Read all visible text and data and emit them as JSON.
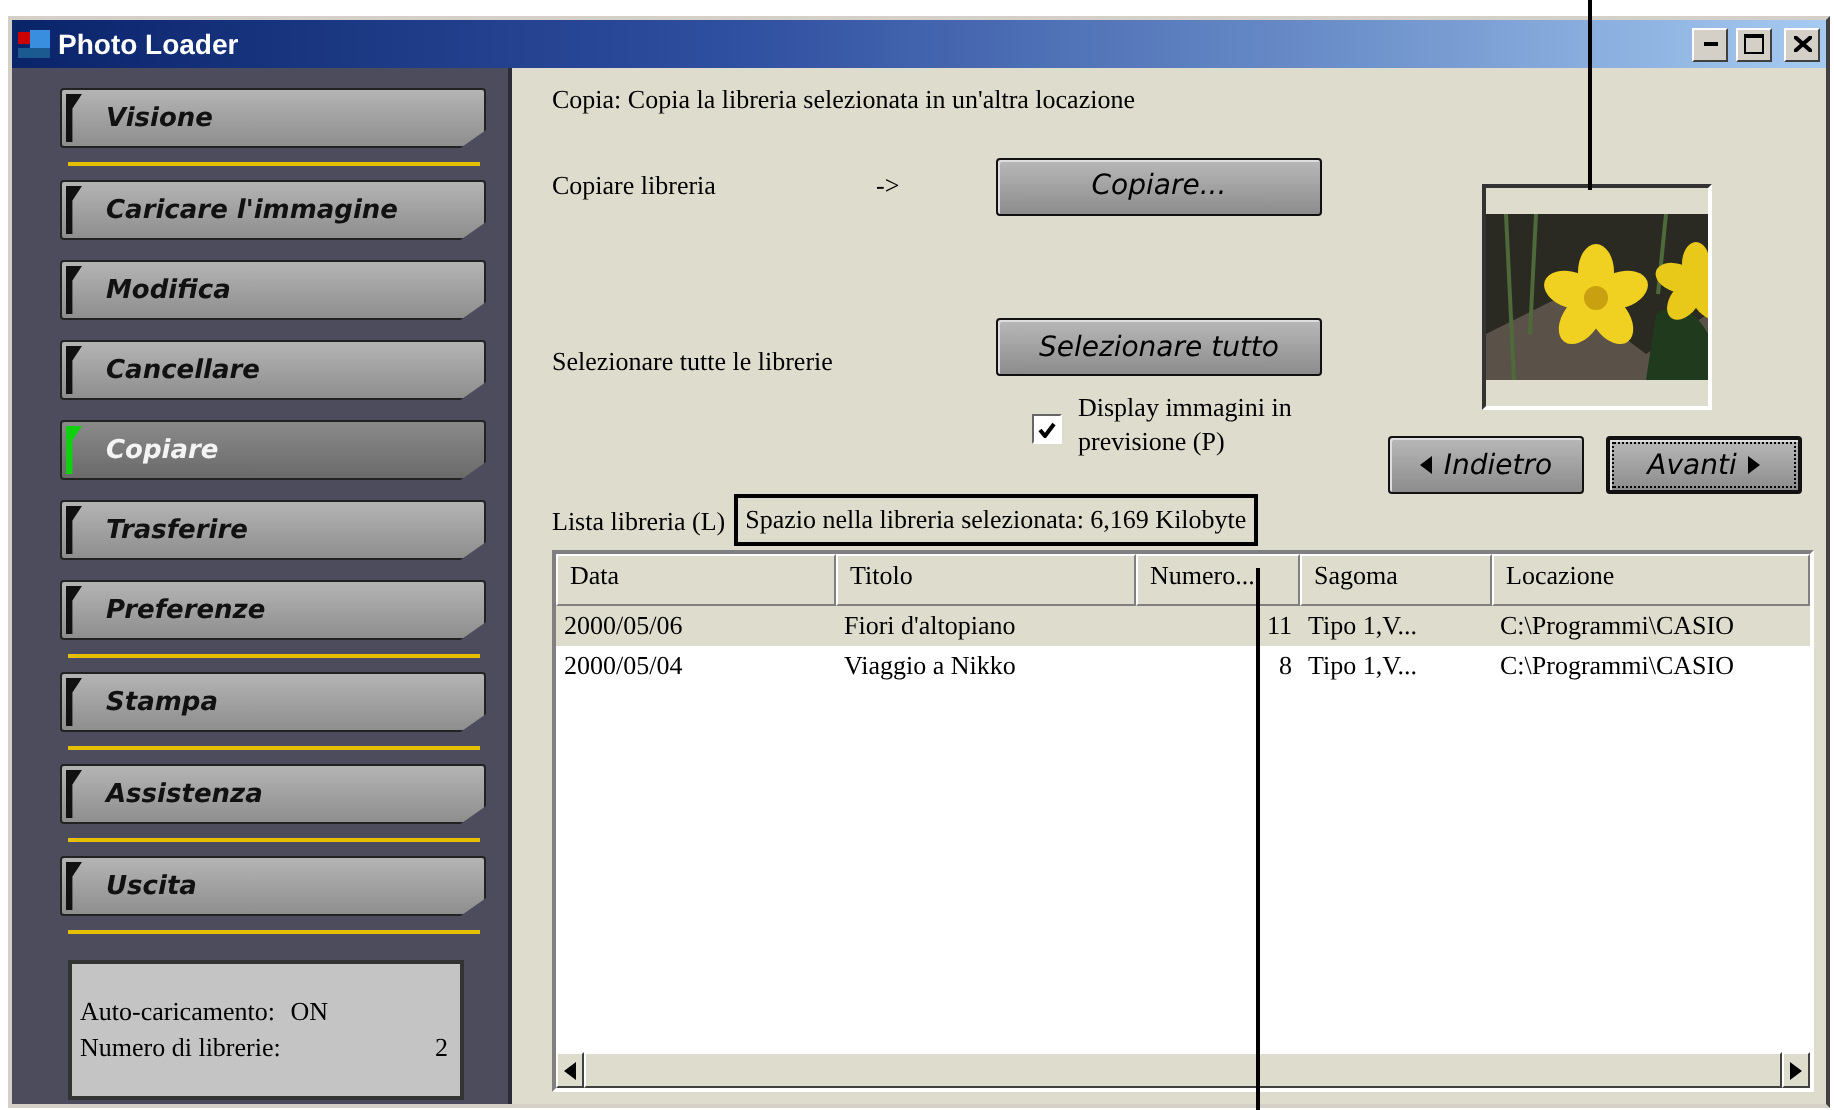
{
  "window": {
    "title": "Photo Loader"
  },
  "sidebar": {
    "groups": [
      [
        {
          "label": "Visione",
          "selected": false
        }
      ],
      [
        {
          "label": "Caricare l'immagine",
          "selected": false
        },
        {
          "label": "Modifica",
          "selected": false
        },
        {
          "label": "Cancellare",
          "selected": false
        },
        {
          "label": "Copiare",
          "selected": true
        },
        {
          "label": "Trasferire",
          "selected": false
        },
        {
          "label": "Preferenze",
          "selected": false
        }
      ],
      [
        {
          "label": "Stampa",
          "selected": false
        }
      ],
      [
        {
          "label": "Assistenza",
          "selected": false
        }
      ],
      [
        {
          "label": "Uscita",
          "selected": false
        }
      ]
    ],
    "info": [
      {
        "label": "Auto-caricamento:",
        "value": "ON"
      },
      {
        "label": "Numero di librerie:",
        "value": "2"
      }
    ]
  },
  "description": "Copia: Copia la libreria selezionata in un'altra locazione",
  "copy_row": {
    "label": "Copiare libreria",
    "arrow": "->",
    "button": "Copiare..."
  },
  "select_row": {
    "label": "Selezionare tutte le librerie",
    "button": "Selezionare tutto"
  },
  "preview": {
    "checkbox": {
      "label": "Display immagini in previsione (P)",
      "checked": true
    }
  },
  "nav_buttons": [
    {
      "label": "Indietro",
      "kind": "back",
      "focused": false
    },
    {
      "label": "Avanti",
      "kind": "next",
      "focused": true
    }
  ],
  "list_label": "Lista libreria (L)",
  "status": "Spazio nella libreria selezionata:  6,169 Kilobyte",
  "table": {
    "columns": [
      "Data",
      "Titolo",
      "Numero...",
      "Sagoma",
      "Locazione"
    ],
    "rows": [
      {
        "cells": [
          "2000/05/06",
          "Fiori d'altopiano",
          "11",
          "Tipo 1,V...",
          "C:\\Programmi\\CASIO"
        ],
        "selected": true
      },
      {
        "cells": [
          "2000/05/04",
          "Viaggio a Nikko",
          "8",
          "Tipo 1,V...",
          "C:\\Programmi\\CASIO"
        ],
        "selected": false
      }
    ]
  }
}
